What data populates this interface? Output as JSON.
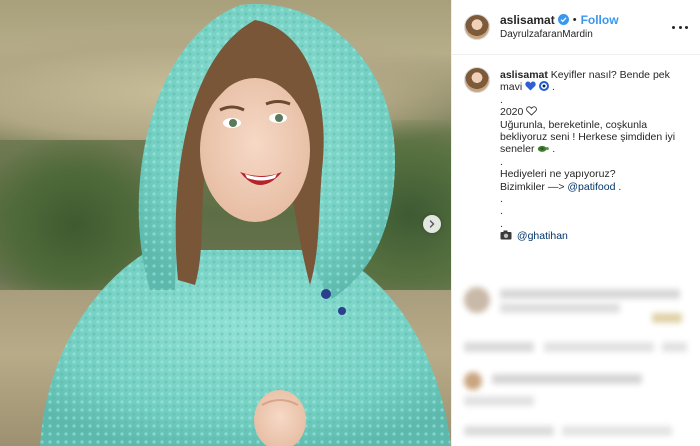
{
  "post": {
    "author": {
      "username": "aslisamat",
      "verified_icon": "verified-badge-icon",
      "follow_label": "Follow",
      "separator": "•",
      "location": "DayrulzafaranMardin"
    },
    "caption": {
      "username": "aslisamat",
      "lines": [
        "Keyifler nasıl? Bende pek",
        "mavi",
        ".",
        "2020",
        "Uğurunla, bereketinle, coşkunla",
        "bekliyoruz seni ! Herkese şimdiden iyi",
        "seneler",
        ".",
        "Hediyeleri ne yapıyoruz?",
        "Bizimkiler —>",
        "@patifood",
        ".",
        ".",
        ".",
        "@ghatihan"
      ],
      "trailing_dot": " ."
    },
    "icons": {
      "more": "more-options-icon",
      "next": "chevron-right-icon",
      "blue_heart": "blue-heart-icon",
      "evil_eye": "evil-eye-icon",
      "outline_heart": "outline-heart-icon",
      "turtle": "turtle-icon",
      "camera": "camera-icon"
    },
    "colors": {
      "follow_blue": "#3897f0",
      "link": "#003569",
      "sweater": "#7fd6c9"
    }
  }
}
